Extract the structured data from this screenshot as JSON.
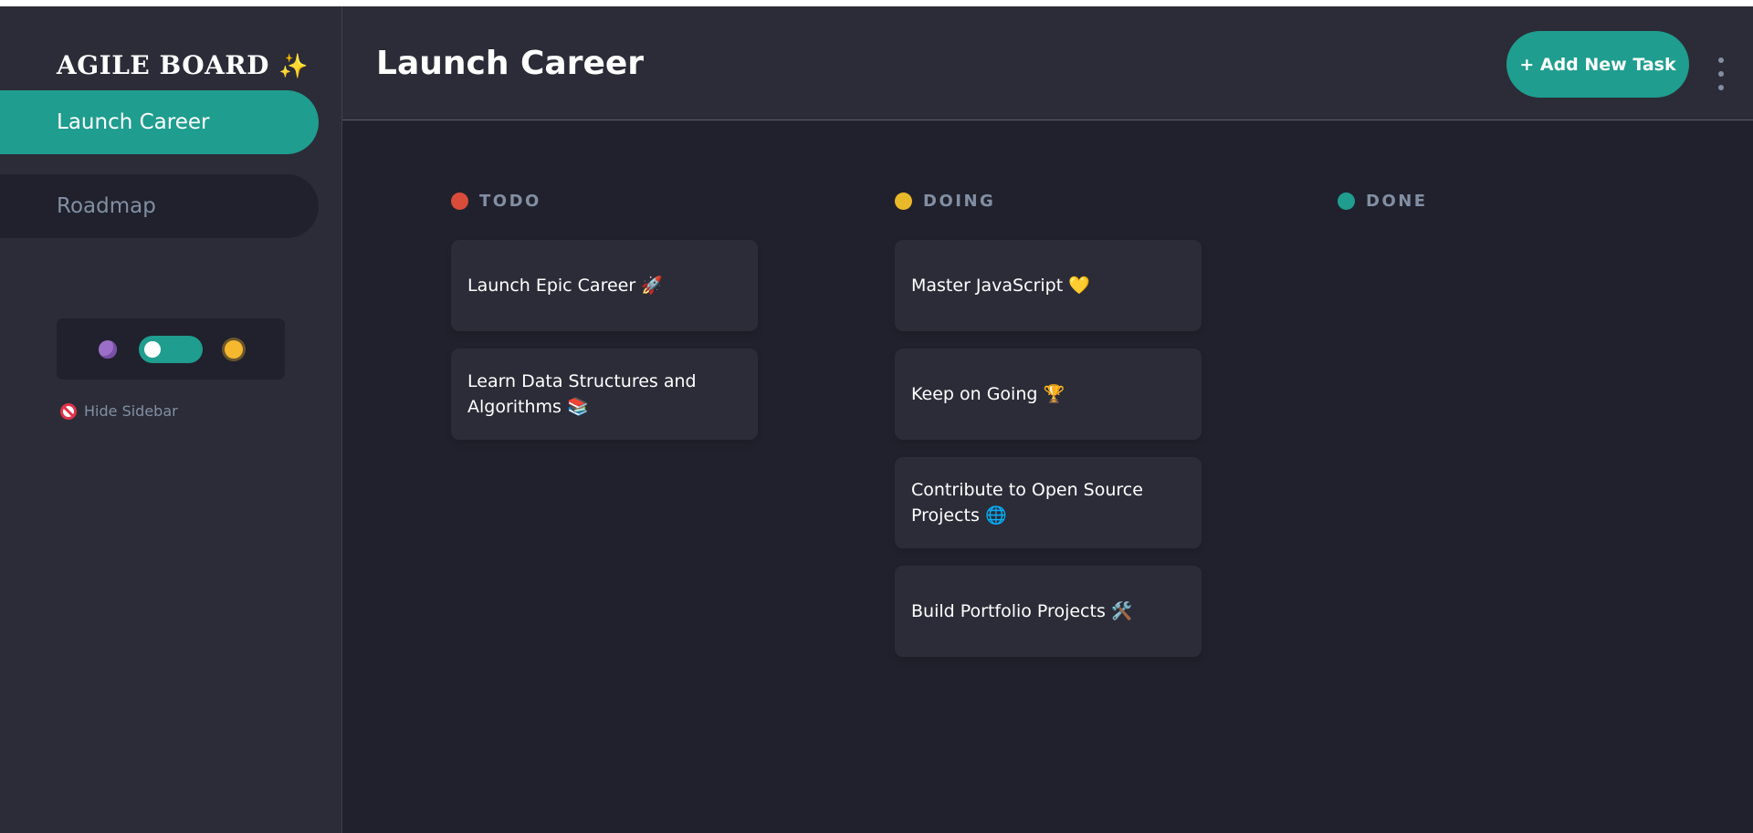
{
  "sidebar": {
    "logo_text": "AGILE BOARD",
    "logo_sparkle": "✨",
    "boards": [
      {
        "label": "Launch Career",
        "active": true
      },
      {
        "label": "Roadmap",
        "active": false
      }
    ],
    "theme": {
      "mode": "dark"
    },
    "hide_label": "Hide Sidebar"
  },
  "header": {
    "title": "Launch Career",
    "add_task_label": "+ Add New Task"
  },
  "columns": [
    {
      "name": "TODO",
      "color": "#d94c3a",
      "tasks": [
        {
          "title": "Launch Epic Career 🚀"
        },
        {
          "title": "Learn Data Structures and Algorithms 📚"
        }
      ]
    },
    {
      "name": "DOING",
      "color": "#e9b92a",
      "tasks": [
        {
          "title": "Master JavaScript 💛"
        },
        {
          "title": "Keep on Going 🏆"
        },
        {
          "title": "Contribute to Open Source Projects 🌐"
        },
        {
          "title": "Build Portfolio Projects 🛠️"
        }
      ]
    },
    {
      "name": "DONE",
      "color": "#1f9d8f",
      "tasks": []
    }
  ],
  "colors": {
    "accent": "#1f9d8f",
    "sidebar_bg": "#2b2c37",
    "board_bg": "#21212d",
    "muted_text": "#828fa3"
  }
}
